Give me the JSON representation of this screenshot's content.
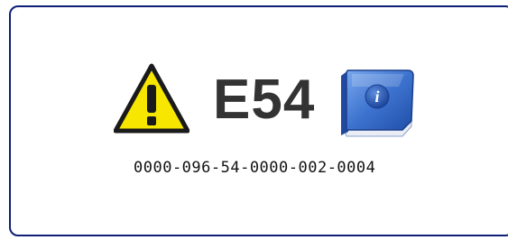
{
  "error": {
    "code": "E54",
    "detail_code": "0000-096-54-0000-002-0004"
  },
  "icons": {
    "warning": "warning-triangle-icon",
    "manual": "info-book-icon"
  },
  "colors": {
    "frame_border": "#0f1f78",
    "warning_fill": "#f7e700",
    "code_text": "#333333",
    "book_blue": "#2f63c0"
  }
}
